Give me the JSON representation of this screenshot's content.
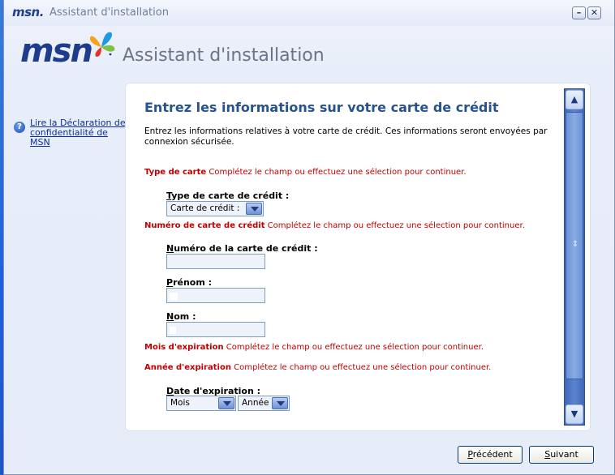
{
  "window": {
    "logo_small": "msn.",
    "title": "Assistant d'installation",
    "minimize_glyph": "–",
    "close_glyph": "✕"
  },
  "banner": {
    "logo": "msn",
    "title": "Assistant d'installation"
  },
  "sidebar": {
    "help_icon": "help-question-icon",
    "link_text": "Lire la Déclaration de confidentialité de MSN"
  },
  "form": {
    "heading": "Entrez les informations sur votre carte de crédit",
    "intro": "Entrez les informations relatives à votre carte de crédit. Ces informations seront envoyées par connexion sécurisée.",
    "errors": {
      "card_type": {
        "field": "Type de carte",
        "message": "Complétez le champ ou effectuez une sélection pour continuer."
      },
      "card_number": {
        "field": "Numéro de carte de crédit",
        "message": "Complétez le champ ou effectuez une sélection pour continuer."
      },
      "exp_month": {
        "field": "Mois d'expiration",
        "message": "Complétez le champ ou effectuez une sélection pour continuer."
      },
      "exp_year": {
        "field": "Année d'expiration",
        "message": "Complétez le champ ou effectuez une sélection pour continuer."
      }
    },
    "card_type": {
      "label_first": "T",
      "label_rest": "ype de carte de crédit :",
      "value": "Carte de crédit :"
    },
    "card_number": {
      "label_first": "N",
      "label_rest": "uméro de la carte de crédit :",
      "value": ""
    },
    "first_name": {
      "label_first": "P",
      "label_rest": "rénom :",
      "value": ""
    },
    "last_name": {
      "label_first": "N",
      "label_rest": "om :",
      "value": ""
    },
    "expiration": {
      "label_first": "D",
      "label_rest": "ate d'expiration :",
      "month_value": "Mois",
      "year_value": "Année"
    }
  },
  "scrollbar": {
    "up_glyph": "▲",
    "down_glyph": "▼",
    "grip_glyph": "⇕"
  },
  "buttons": {
    "previous": {
      "first": "P",
      "rest": "récédent"
    },
    "next": {
      "first": "S",
      "rest": "uivant"
    }
  },
  "colors": {
    "error": "#c00000",
    "heading": "#26528f",
    "link": "#0d2e9e",
    "desktop": "#3a6ea5"
  }
}
